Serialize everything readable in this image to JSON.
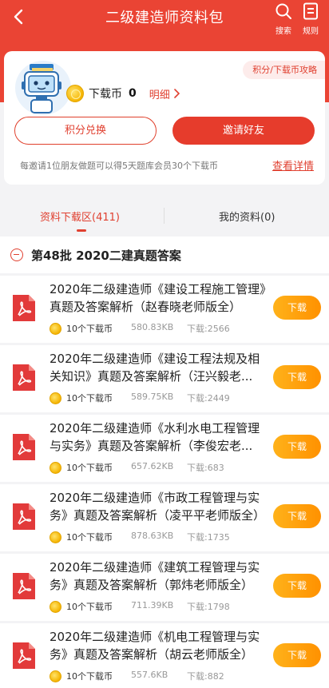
{
  "header": {
    "title": "二级建造师资料包",
    "search_label": "搜索",
    "rules_label": "规则"
  },
  "account": {
    "coin_label": "下载币",
    "coin_count": "0",
    "detail_label": "明细",
    "strategy_label": "积分/下载币攻略",
    "exchange_label": "积分兑换",
    "invite_label": "邀请好友",
    "invite_note": "每邀请1位朋友做题可以得5天题库会员30个下载币",
    "view_detail_label": "查看详情"
  },
  "tabs": [
    {
      "label": "资料下载区(411)",
      "active": true
    },
    {
      "label": "我的资料(0)",
      "active": false
    }
  ],
  "group": {
    "title": "第48批 2020二建真题答案"
  },
  "items": [
    {
      "title": "2020年二级建造师《建设工程施工管理》真题及答案解析（赵春晓老师版全）",
      "price": "10个下载币",
      "size": "580.83KB",
      "downloads": "下载:2566",
      "button": "下载"
    },
    {
      "title": "2020年二级建造师《建设工程法规及相关知识》真题及答案解析（汪兴毅老...",
      "price": "10个下载币",
      "size": "589.75KB",
      "downloads": "下载:2449",
      "button": "下载"
    },
    {
      "title": "2020年二级建造师《水利水电工程管理与实务》真题及答案解析（李俊宏老...",
      "price": "10个下载币",
      "size": "657.62KB",
      "downloads": "下载:683",
      "button": "下载"
    },
    {
      "title": "2020年二级建造师《市政工程管理与实务》真题及答案解析（凌平平老师版全）",
      "price": "10个下载币",
      "size": "878.63KB",
      "downloads": "下载:1735",
      "button": "下载"
    },
    {
      "title": "2020年二级建造师《建筑工程管理与实务》真题及答案解析（郭炜老师版全）",
      "price": "10个下载币",
      "size": "711.39KB",
      "downloads": "下载:1798",
      "button": "下载"
    },
    {
      "title": "2020年二级建造师《机电工程管理与实务》真题及答案解析（胡云老师版全）",
      "price": "10个下载币",
      "size": "557.6KB",
      "downloads": "下载:882",
      "button": "下载"
    }
  ],
  "colors": {
    "brand": "#ea4434",
    "accent": "#e04030",
    "download": "#ff9d0a",
    "pdf": "#e23a3a"
  }
}
